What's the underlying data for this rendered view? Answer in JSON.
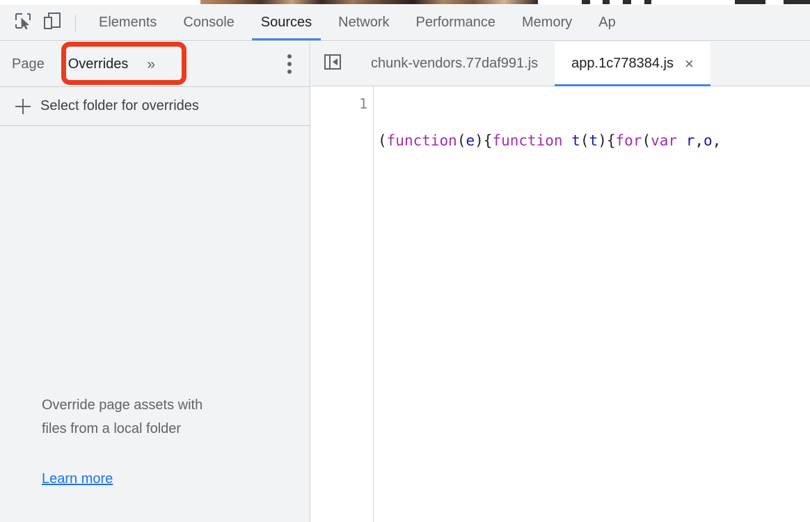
{
  "devtools": {
    "toolbar": {
      "inspect_icon": "inspect-element-icon",
      "device_toolbar_icon": "device-toolbar-icon",
      "tabs": [
        {
          "label": "Elements",
          "active": false
        },
        {
          "label": "Console",
          "active": false
        },
        {
          "label": "Sources",
          "active": true
        },
        {
          "label": "Network",
          "active": false
        },
        {
          "label": "Performance",
          "active": false
        },
        {
          "label": "Memory",
          "active": false
        },
        {
          "label": "Ap",
          "active": false
        }
      ],
      "active_tab": "Sources",
      "accent_color": "#4285f4"
    },
    "sidebar": {
      "tabs": [
        {
          "label": "Page",
          "selected": false
        },
        {
          "label": "Overrides",
          "selected": true
        }
      ],
      "overflow_icon": "chevron-double-right-icon",
      "overflow_label": "»",
      "more_options_icon": "more-vertical-icon",
      "add_folder": {
        "icon": "plus-icon",
        "label": "Select folder for overrides"
      },
      "empty_state": {
        "line1": "Override page assets with",
        "line2": "files from a local folder",
        "link_label": "Learn more",
        "link_color": "#1a73e8"
      }
    },
    "annotation": {
      "target": "Overrides",
      "color": "#eb3b1e"
    },
    "editor": {
      "collapse_icon": "panel-collapse-left-icon",
      "tabs": [
        {
          "label": "chunk-vendors.77daf991.js",
          "active": false,
          "closable": false
        },
        {
          "label": "app.1c778384.js",
          "active": true,
          "closable": true
        }
      ],
      "close_icon": "close-icon",
      "close_label": "×",
      "gutter": {
        "line_numbers": [
          "1"
        ]
      },
      "code": {
        "line1": [
          {
            "text": "(",
            "type": "plain"
          },
          {
            "text": "function",
            "type": "keyword"
          },
          {
            "text": "(",
            "type": "plain"
          },
          {
            "text": "e",
            "type": "variable"
          },
          {
            "text": "){",
            "type": "plain"
          },
          {
            "text": "function",
            "type": "keyword"
          },
          {
            "text": " ",
            "type": "plain"
          },
          {
            "text": "t",
            "type": "variable"
          },
          {
            "text": "(",
            "type": "plain"
          },
          {
            "text": "t",
            "type": "variable"
          },
          {
            "text": "){",
            "type": "plain"
          },
          {
            "text": "for",
            "type": "keyword"
          },
          {
            "text": "(",
            "type": "plain"
          },
          {
            "text": "var",
            "type": "keyword"
          },
          {
            "text": " ",
            "type": "plain"
          },
          {
            "text": "r",
            "type": "variable"
          },
          {
            "text": ",",
            "type": "plain"
          },
          {
            "text": "o",
            "type": "variable"
          },
          {
            "text": ",",
            "type": "plain"
          }
        ],
        "plain_text": "(function(e){function t(t){for(var r,o,",
        "syntax_colors": {
          "keyword": "#a32eae",
          "variable": "#1a1aa6",
          "plain": "#202124"
        }
      }
    }
  }
}
